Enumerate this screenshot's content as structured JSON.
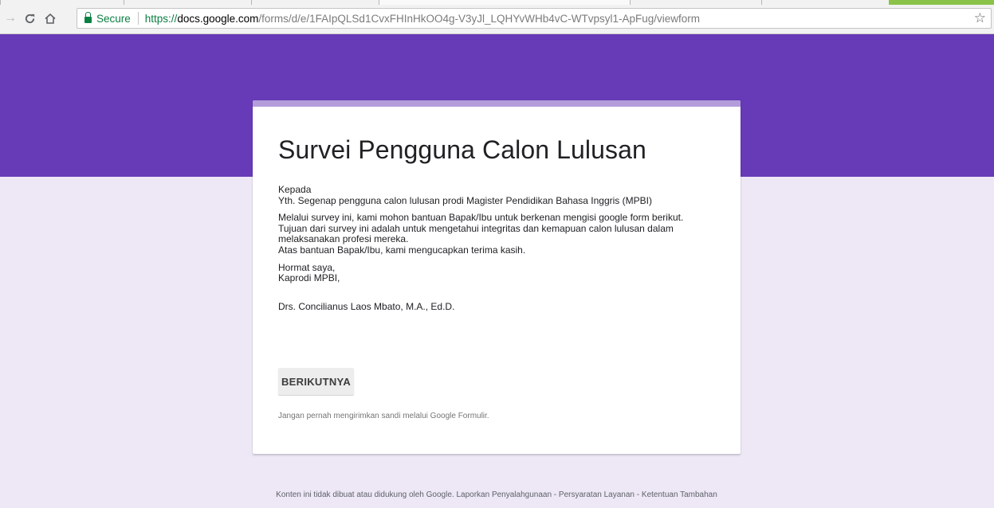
{
  "browser": {
    "back_icon": "arrow-left-icon",
    "reload_icon": "reload-icon",
    "home_icon": "home-icon",
    "secure_label": "Secure",
    "url_protocol": "https://",
    "url_host": "docs.google.com",
    "url_path": "/forms/d/e/1FAIpQLSd1CvxFHInHkOO4g-V3yJl_LQHYvWHb4vC-WTvpsyl1-ApFug/viewform",
    "bookmark_icon": "star-icon"
  },
  "colors": {
    "header": "#673ab7",
    "background": "#ede7f6",
    "accent": "#b39ddb"
  },
  "form": {
    "title": "Survei Pengguna Calon Lulusan",
    "description": {
      "p1_line1": "Kepada",
      "p1_line2": "Yth. Segenap pengguna calon lulusan prodi Magister Pendidikan Bahasa Inggris (MPBI)",
      "p2_line1": "Melalui survey ini, kami mohon bantuan Bapak/Ibu untuk berkenan mengisi google form berikut.",
      "p2_line2": "Tujuan dari survey ini adalah untuk mengetahui integritas dan kemapuan calon lulusan dalam",
      "p2_line3": "melaksanakan profesi mereka.",
      "p2_line4": "Atas bantuan Bapak/Ibu, kami mengucapkan terima kasih.",
      "p3_line1": "Hormat saya,",
      "p3_line2": "Kaprodi MPBI,",
      "signature": "Drs. Concilianus Laos Mbato, M.A., Ed.D."
    },
    "next_button": "BERIKUTNYA",
    "password_warning": "Jangan pernah mengirimkan sandi melalui Google Formulir."
  },
  "footer": {
    "text": "Konten ini tidak dibuat atau didukung oleh Google.",
    "report_link": "Laporkan Penyalahgunaan",
    "dash1": "-",
    "terms_link": "Persyaratan Layanan",
    "dash2": "-",
    "additional_link": "Ketentuan Tambahan"
  }
}
